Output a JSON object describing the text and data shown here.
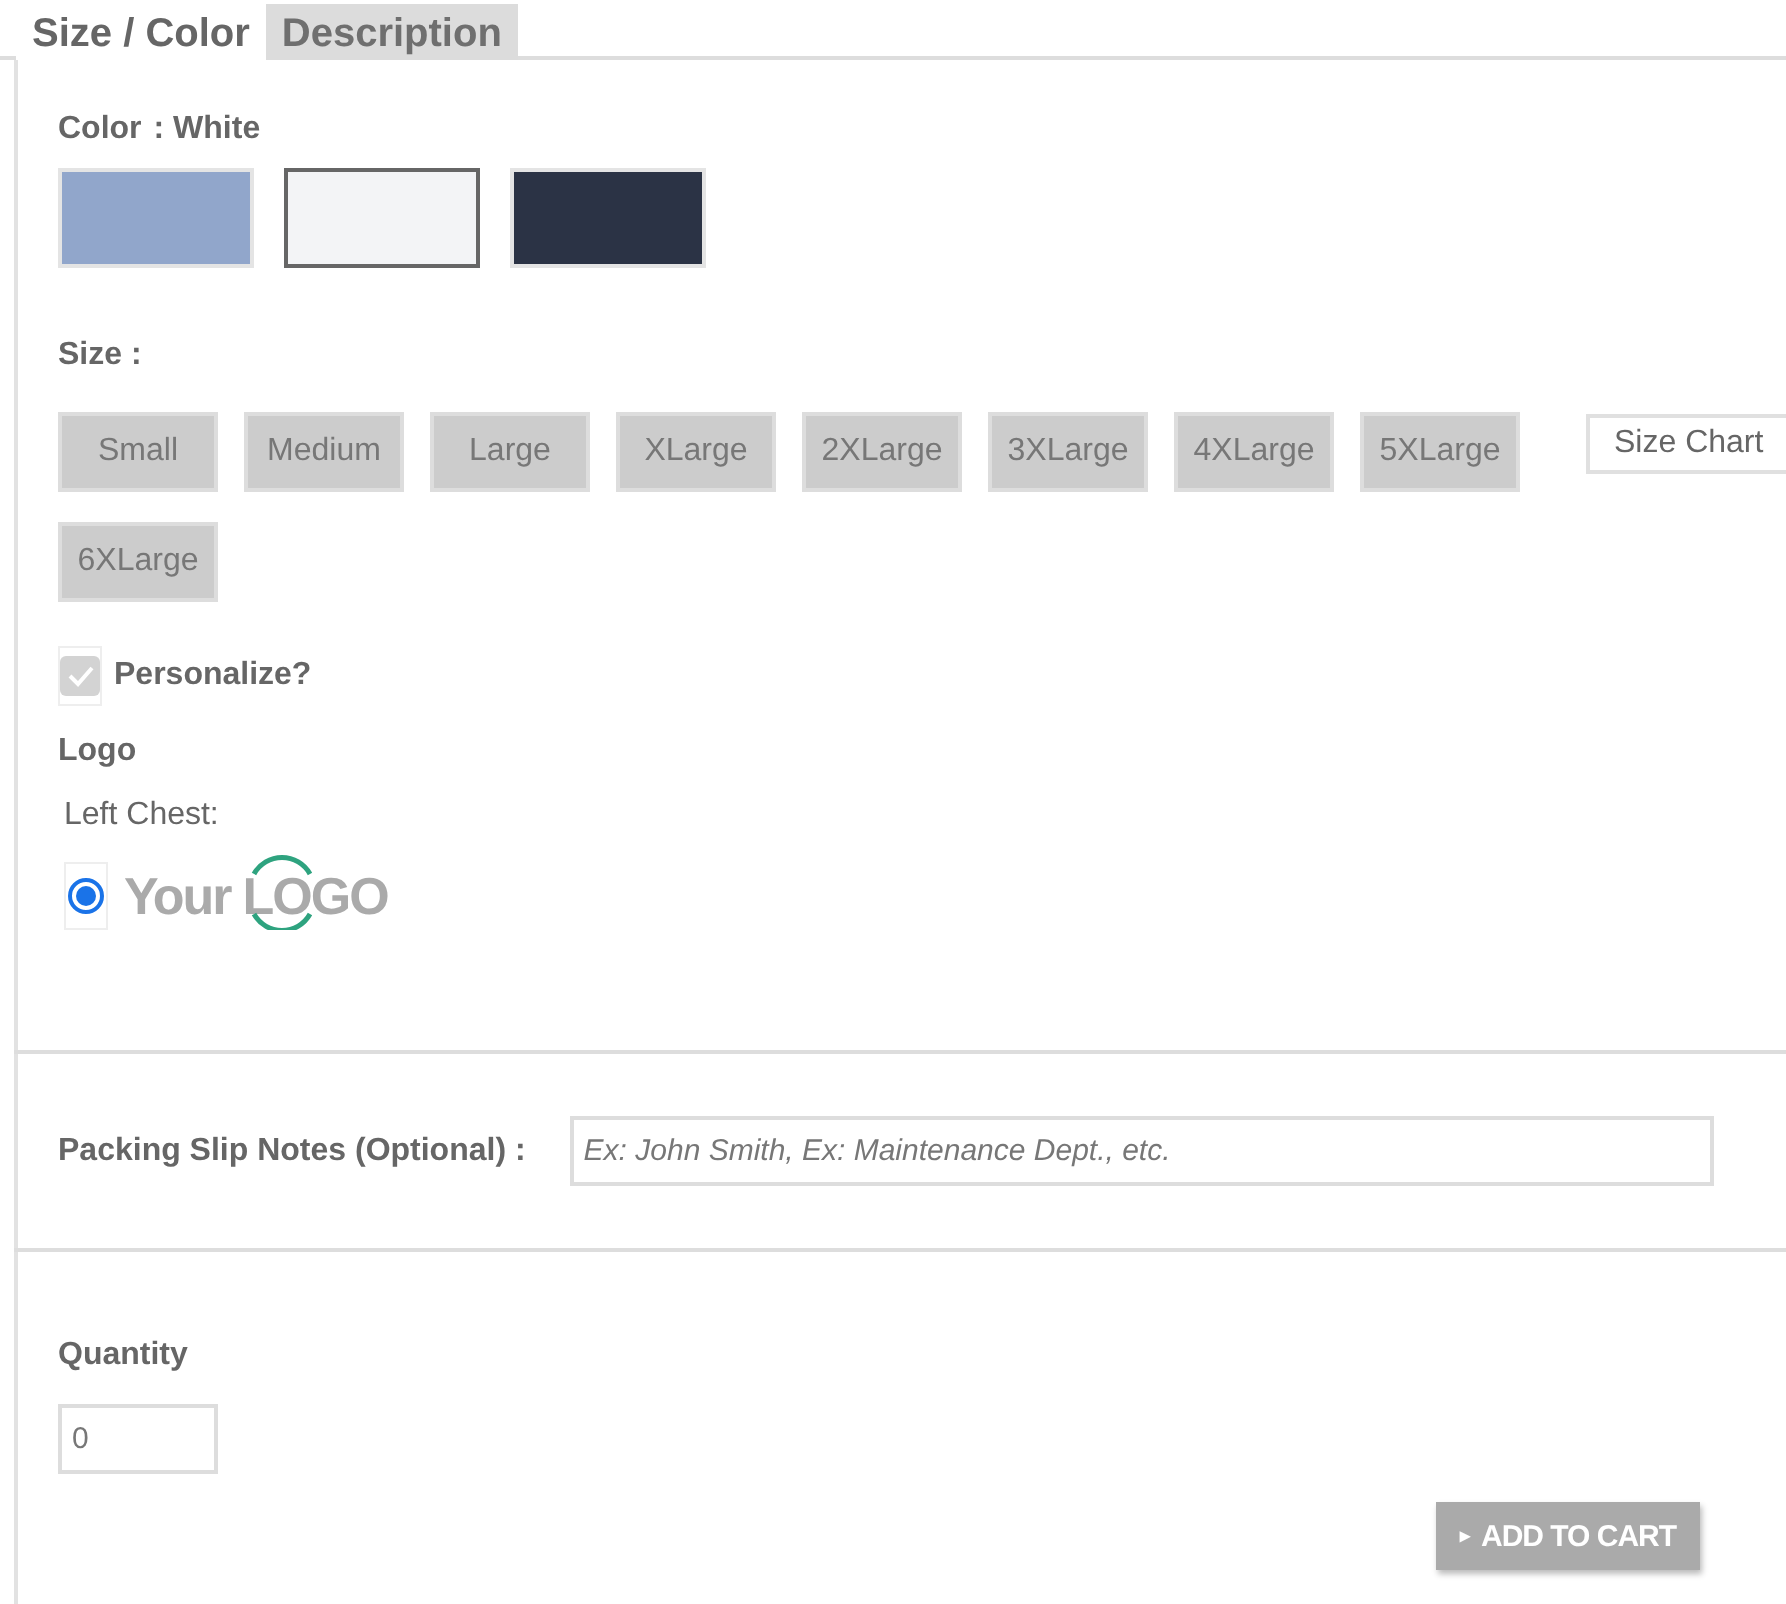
{
  "tabs": [
    {
      "label": "Size / Color",
      "selected": true
    },
    {
      "label": "Description",
      "selected": false
    }
  ],
  "color": {
    "label": "Color",
    "value": ": White",
    "swatches": [
      {
        "color": "#91a6cb",
        "selected": false
      },
      {
        "color": "#f3f4f6",
        "selected": true
      },
      {
        "color": "#2b3345",
        "selected": false
      }
    ]
  },
  "size": {
    "label": "Size :",
    "options": [
      "Small",
      "Medium",
      "Large",
      "XLarge",
      "2XLarge",
      "3XLarge",
      "4XLarge",
      "5XLarge",
      "6XLarge"
    ],
    "chart_button": "Size Chart"
  },
  "personalize": {
    "label": "Personalize?",
    "checked": true
  },
  "logo": {
    "heading": "Logo",
    "location": "Left Chest:",
    "options": [
      {
        "word": "Your",
        "mark": "LOGO",
        "selected": true
      }
    ]
  },
  "notes": {
    "label": "Packing Slip Notes (Optional) :",
    "placeholder": "Ex: John Smith, Ex: Maintenance Dept., etc."
  },
  "quantity": {
    "label": "Quantity",
    "value": "0"
  },
  "add_to_cart": {
    "icon": "▸",
    "label": "ADD TO CART"
  }
}
